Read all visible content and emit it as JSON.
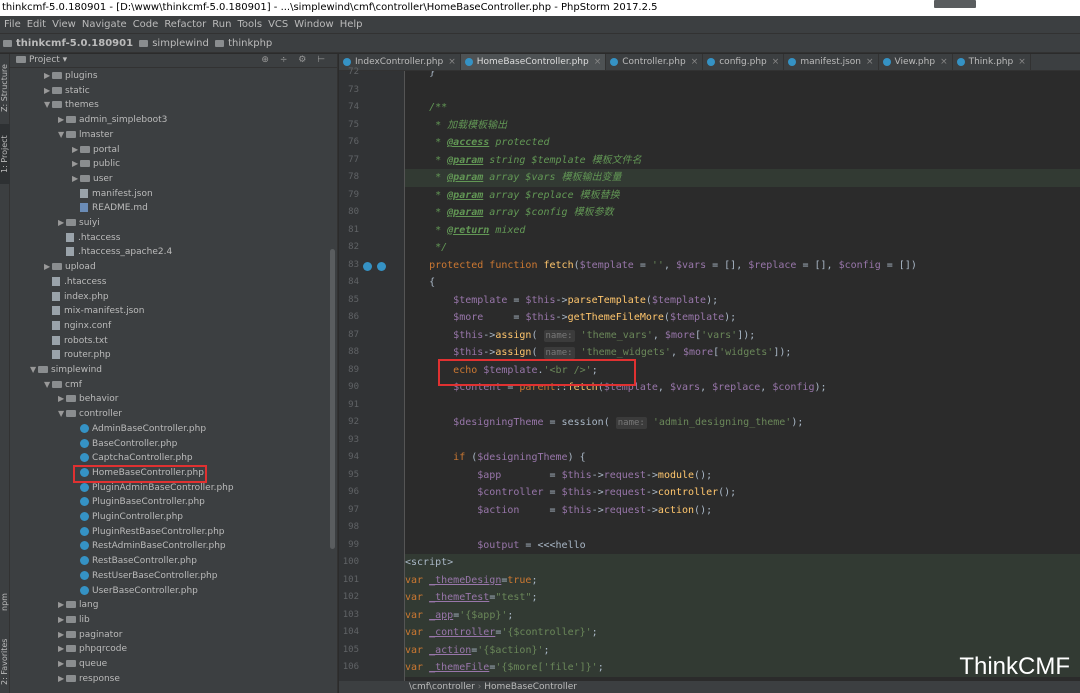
{
  "window": {
    "title": "thinkcmf-5.0.180901 - [D:\\www\\thinkcmf-5.0.180901] - ...\\simplewind\\cmf\\controller\\HomeBaseController.php - PhpStorm 2017.2.5"
  },
  "menu": [
    "File",
    "Edit",
    "View",
    "Navigate",
    "Code",
    "Refactor",
    "Run",
    "Tools",
    "VCS",
    "Window",
    "Help"
  ],
  "breadcrumb": [
    "thinkcmf-5.0.180901",
    "simplewind",
    "thinkphp"
  ],
  "side_tabs": {
    "structure": "Z: Structure",
    "project": "1: Project",
    "npm": "npm",
    "favorites": "2: Favorites"
  },
  "project_panel": {
    "title": "Project",
    "tree": [
      {
        "label": "plugins",
        "type": "folder",
        "depth": 2,
        "state": "collapsed"
      },
      {
        "label": "static",
        "type": "folder",
        "depth": 2,
        "state": "collapsed"
      },
      {
        "label": "themes",
        "type": "folder",
        "depth": 2,
        "state": "expanded"
      },
      {
        "label": "admin_simpleboot3",
        "type": "folder",
        "depth": 3,
        "state": "collapsed"
      },
      {
        "label": "lmaster",
        "type": "folder",
        "depth": 3,
        "state": "expanded"
      },
      {
        "label": "portal",
        "type": "folder",
        "depth": 4,
        "state": "collapsed"
      },
      {
        "label": "public",
        "type": "folder",
        "depth": 4,
        "state": "collapsed"
      },
      {
        "label": "user",
        "type": "folder",
        "depth": 4,
        "state": "collapsed"
      },
      {
        "label": "manifest.json",
        "type": "file",
        "depth": 4
      },
      {
        "label": "README.md",
        "type": "md",
        "depth": 4
      },
      {
        "label": "suiyi",
        "type": "folder",
        "depth": 3,
        "state": "collapsed"
      },
      {
        "label": ".htaccess",
        "type": "file",
        "depth": 3
      },
      {
        "label": ".htaccess_apache2.4",
        "type": "file",
        "depth": 3
      },
      {
        "label": "upload",
        "type": "folder",
        "depth": 2,
        "state": "collapsed"
      },
      {
        "label": ".htaccess",
        "type": "file",
        "depth": 2
      },
      {
        "label": "index.php",
        "type": "file",
        "depth": 2
      },
      {
        "label": "mix-manifest.json",
        "type": "file",
        "depth": 2
      },
      {
        "label": "nginx.conf",
        "type": "file",
        "depth": 2
      },
      {
        "label": "robots.txt",
        "type": "file",
        "depth": 2
      },
      {
        "label": "router.php",
        "type": "file",
        "depth": 2
      },
      {
        "label": "simplewind",
        "type": "folder",
        "depth": 1,
        "state": "expanded"
      },
      {
        "label": "cmf",
        "type": "folder",
        "depth": 2,
        "state": "expanded"
      },
      {
        "label": "behavior",
        "type": "folder",
        "depth": 3,
        "state": "collapsed"
      },
      {
        "label": "controller",
        "type": "folder",
        "depth": 3,
        "state": "expanded"
      },
      {
        "label": "AdminBaseController.php",
        "type": "class",
        "depth": 4
      },
      {
        "label": "BaseController.php",
        "type": "class",
        "depth": 4
      },
      {
        "label": "CaptchaController.php",
        "type": "class",
        "depth": 4
      },
      {
        "label": "HomeBaseController.php",
        "type": "class",
        "depth": 4,
        "highlight": true
      },
      {
        "label": "PluginAdminBaseController.php",
        "type": "class",
        "depth": 4
      },
      {
        "label": "PluginBaseController.php",
        "type": "class",
        "depth": 4
      },
      {
        "label": "PluginController.php",
        "type": "class",
        "depth": 4
      },
      {
        "label": "PluginRestBaseController.php",
        "type": "class",
        "depth": 4
      },
      {
        "label": "RestAdminBaseController.php",
        "type": "class",
        "depth": 4
      },
      {
        "label": "RestBaseController.php",
        "type": "class",
        "depth": 4
      },
      {
        "label": "RestUserBaseController.php",
        "type": "class",
        "depth": 4
      },
      {
        "label": "UserBaseController.php",
        "type": "class",
        "depth": 4
      },
      {
        "label": "lang",
        "type": "folder",
        "depth": 3,
        "state": "collapsed"
      },
      {
        "label": "lib",
        "type": "folder",
        "depth": 3,
        "state": "collapsed"
      },
      {
        "label": "paginator",
        "type": "folder",
        "depth": 3,
        "state": "collapsed"
      },
      {
        "label": "phpqrcode",
        "type": "folder",
        "depth": 3,
        "state": "collapsed"
      },
      {
        "label": "queue",
        "type": "folder",
        "depth": 3,
        "state": "collapsed"
      },
      {
        "label": "response",
        "type": "folder",
        "depth": 3,
        "state": "collapsed"
      }
    ]
  },
  "editor_tabs": [
    {
      "label": "IndexController.php",
      "active": false
    },
    {
      "label": "HomeBaseController.php",
      "active": true
    },
    {
      "label": "Controller.php",
      "active": false
    },
    {
      "label": "config.php",
      "active": false
    },
    {
      "label": "manifest.json",
      "active": false
    },
    {
      "label": "View.php",
      "active": false
    },
    {
      "label": "Think.php",
      "active": false
    }
  ],
  "code": {
    "first_line": 72,
    "lines": [
      {
        "n": "72",
        "html": "    }"
      },
      {
        "n": "73",
        "html": ""
      },
      {
        "n": "74",
        "html": "    <span class=\"cmt\">/**</span>"
      },
      {
        "n": "75",
        "html": "<span class=\"cmt\">     * 加载模板输出</span>"
      },
      {
        "n": "76",
        "html": "<span class=\"cmt\">     * <span class=\"tag\">@access</span> protected</span>"
      },
      {
        "n": "77",
        "html": "<span class=\"cmt\">     * <span class=\"tag\">@param</span> string $template 模板文件名</span>"
      },
      {
        "n": "78",
        "html": "<span class=\"cmt\">     * <span class=\"tag\">@param</span> array $vars 模板输出变量</span>",
        "hl": true
      },
      {
        "n": "79",
        "html": "<span class=\"cmt\">     * <span class=\"tag\">@param</span> array $replace 模板替换</span>"
      },
      {
        "n": "80",
        "html": "<span class=\"cmt\">     * <span class=\"tag\">@param</span> array $config 模板参数</span>"
      },
      {
        "n": "81",
        "html": "<span class=\"cmt\">     * <span class=\"tag\">@return</span> mixed</span>"
      },
      {
        "n": "82",
        "html": "<span class=\"cmt\">     */</span>"
      },
      {
        "n": "83",
        "html": "    <span class=\"kw\">protected function</span> <span class=\"fn\">fetch</span>(<span class=\"var\">$template</span> = <span class=\"str\">''</span>, <span class=\"var\">$vars</span> = [], <span class=\"var\">$replace</span> = [], <span class=\"var\">$config</span> = [])"
      },
      {
        "n": "84",
        "html": "    {"
      },
      {
        "n": "85",
        "html": "        <span class=\"var\">$template</span> = <span class=\"var\">$this</span>-><span class=\"fn\">parseTemplate</span>(<span class=\"var\">$template</span>);"
      },
      {
        "n": "86",
        "html": "        <span class=\"var\">$more</span>     = <span class=\"var\">$this</span>-><span class=\"fn\">getThemeFileMore</span>(<span class=\"var\">$template</span>);"
      },
      {
        "n": "87",
        "html": "        <span class=\"var\">$this</span>-><span class=\"fn\">assign</span>( <span class=\"hint\">name:</span> <span class=\"str\">'theme_vars'</span>, <span class=\"var\">$more</span>[<span class=\"str\">'vars'</span>]);"
      },
      {
        "n": "88",
        "html": "        <span class=\"var\">$this</span>-><span class=\"fn\">assign</span>( <span class=\"hint\">name:</span> <span class=\"str\">'theme_widgets'</span>, <span class=\"var\">$more</span>[<span class=\"str\">'widgets'</span>]);"
      },
      {
        "n": "89",
        "html": "        <span class=\"kw\">echo</span> <span class=\"var\">$template</span>.<span class=\"str\">'&lt;br /&gt;'</span>;"
      },
      {
        "n": "90",
        "html": "        <span class=\"var\">$content</span> = <span class=\"kw\">parent</span>::<span class=\"fn\">fetch</span>(<span class=\"var\">$template</span>, <span class=\"var\">$vars</span>, <span class=\"var\">$replace</span>, <span class=\"var\">$config</span>);"
      },
      {
        "n": "91",
        "html": ""
      },
      {
        "n": "92",
        "html": "        <span class=\"var\">$designingTheme</span> = session( <span class=\"hint\">name:</span> <span class=\"str\">'admin_designing_theme'</span>);"
      },
      {
        "n": "93",
        "html": ""
      },
      {
        "n": "94",
        "html": "        <span class=\"kw\">if</span> (<span class=\"var\">$designingTheme</span>) {"
      },
      {
        "n": "95",
        "html": "            <span class=\"var\">$app</span>        = <span class=\"var\">$this</span>-><span class=\"var\">request</span>-><span class=\"fn\">module</span>();"
      },
      {
        "n": "96",
        "html": "            <span class=\"var\">$controller</span> = <span class=\"var\">$this</span>-><span class=\"var\">request</span>-><span class=\"fn\">controller</span>();"
      },
      {
        "n": "97",
        "html": "            <span class=\"var\">$action</span>     = <span class=\"var\">$this</span>-><span class=\"var\">request</span>-><span class=\"fn\">action</span>();"
      },
      {
        "n": "98",
        "html": ""
      },
      {
        "n": "99",
        "html": "            <span class=\"var\">$output</span> = &lt;&lt;&lt;hello"
      },
      {
        "n": "100",
        "html": "&lt;script&gt;",
        "hl": true
      },
      {
        "n": "101",
        "html": "<span class=\"kw\">var</span> <span class=\"svar\">_themeDesign</span>=<span class=\"kw\">true</span>;",
        "hl": true
      },
      {
        "n": "102",
        "html": "<span class=\"kw\">var</span> <span class=\"svar\">_themeTest</span>=<span class=\"str\">\"test\"</span>;",
        "hl": true
      },
      {
        "n": "103",
        "html": "<span class=\"kw\">var</span> <span class=\"svar\">_app</span>=<span class=\"str\">'{$app}'</span>;",
        "hl": true
      },
      {
        "n": "104",
        "html": "<span class=\"kw\">var</span> <span class=\"svar\">_controller</span>=<span class=\"str\">'{$controller}'</span>;",
        "hl": true
      },
      {
        "n": "105",
        "html": "<span class=\"kw\">var</span> <span class=\"svar\">_action</span>=<span class=\"str\">'{$action}'</span>;",
        "hl": true
      },
      {
        "n": "106",
        "html": "<span class=\"kw\">var</span> <span class=\"svar\">_themeFile</span>=<span class=\"str\">'{$more['file']}'</span>;",
        "hl": true
      }
    ]
  },
  "status_path": [
    "\\cmf\\controller",
    "HomeBaseController"
  ],
  "watermark": "ThinkCMF"
}
